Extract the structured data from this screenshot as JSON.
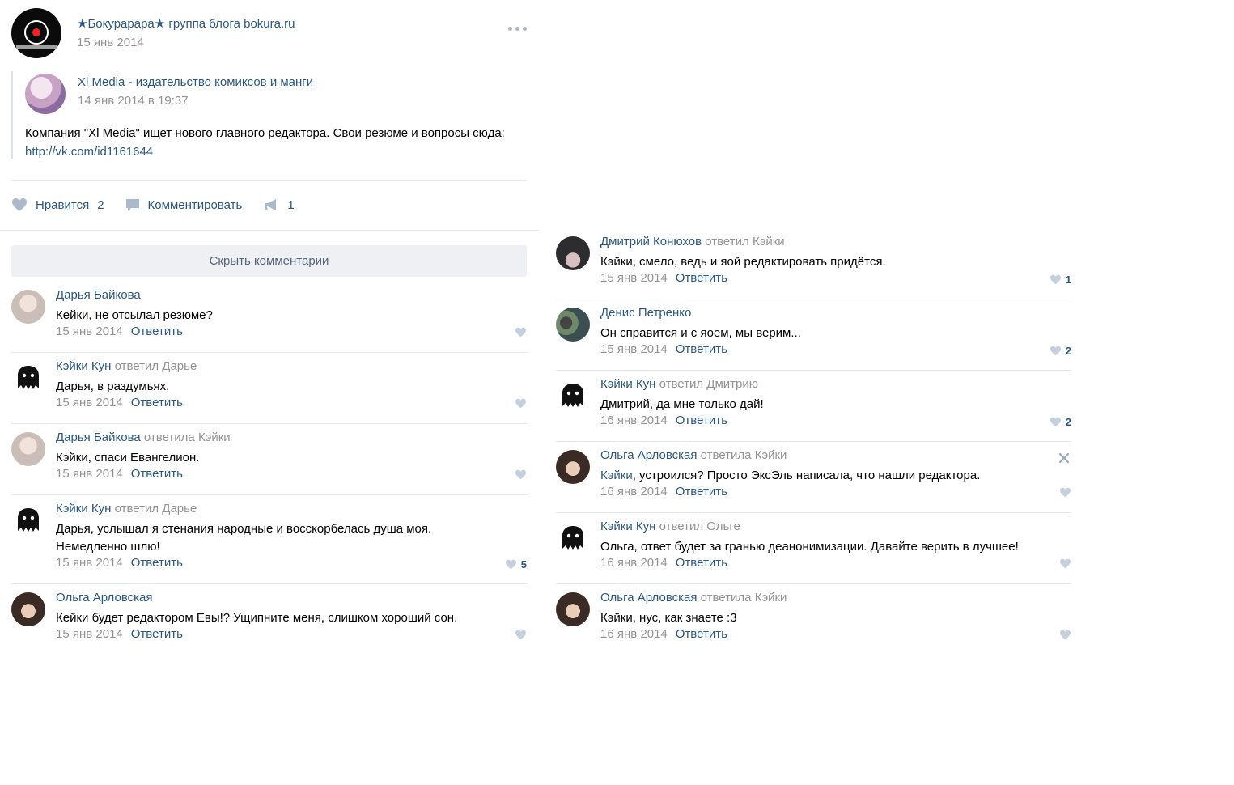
{
  "post": {
    "group_name": "★Бокурарара★ группа блога bokura.ru",
    "date": "15 янв 2014",
    "more_icon": "more-horizontal-icon",
    "repost": {
      "author": "Xl Media - издательство комиксов и манги",
      "date": "14 янв 2014 в 19:37",
      "text": "Компания \"Xl Media\" ищет нового главного редактора. Свои резюме и вопросы сюда: ",
      "link": "http://vk.com/id1161644"
    },
    "actions": {
      "like_label": "Нравится",
      "like_count": "2",
      "comment_label": "Комментировать",
      "share_count": "1"
    },
    "hide_comments": "Скрыть комментарии"
  },
  "reply_label": "Ответить",
  "comments_left": [
    {
      "author": "Дарья Байкова",
      "replied": "",
      "to": "",
      "text": "Кейки, не отсылал резюме?",
      "date": "15 янв 2014",
      "likes": "",
      "avatar": "girl"
    },
    {
      "author": "Кэйки Кун",
      "replied": "ответил",
      "to": "Дарье",
      "text": "Дарья, в раздумьях.",
      "date": "15 янв 2014",
      "likes": "",
      "avatar": "ghost"
    },
    {
      "author": "Дарья Байкова",
      "replied": "ответила",
      "to": "Кэйки",
      "text": "Кэйки, спаси Евангелион.",
      "date": "15 янв 2014",
      "likes": "",
      "avatar": "girl"
    },
    {
      "author": "Кэйки Кун",
      "replied": "ответил",
      "to": "Дарье",
      "text": "Дарья, услышал я стенания народные и восскорбелась душа моя.",
      "text2": "Немедленно шлю!",
      "date": "15 янв 2014",
      "likes": "5",
      "avatar": "ghost"
    },
    {
      "author": "Ольга Арловская",
      "replied": "",
      "to": "",
      "text": "Кейки будет редактором Евы!? Ущипните меня, слишком хороший сон.",
      "date": "15 янв 2014",
      "likes": "",
      "avatar": "olga"
    }
  ],
  "comments_right": [
    {
      "author": "Дмитрий Конюхов",
      "replied": "ответил",
      "to": "Кэйки",
      "text": "Кэйки, смело, ведь и яой редактировать придётся.",
      "date": "15 янв 2014",
      "likes": "1",
      "avatar": "dim"
    },
    {
      "author": "Денис Петренко",
      "replied": "",
      "to": "",
      "text": "Он справится и с яоем, мы верим...",
      "date": "15 янв 2014",
      "likes": "2",
      "avatar": "den"
    },
    {
      "author": "Кэйки Кун",
      "replied": "ответил",
      "to": "Дмитрию",
      "text": "Дмитрий, да мне только дай!",
      "date": "16 янв 2014",
      "likes": "2",
      "avatar": "ghost"
    },
    {
      "author": "Ольга Арловская",
      "replied": "ответила",
      "to": "Кэйки",
      "mention": "Кэйки",
      "text": ", устроился? Просто ЭксЭль написала, что нашли редактора.",
      "date": "16 янв 2014",
      "likes": "",
      "avatar": "olga",
      "closable": true
    },
    {
      "author": "Кэйки Кун",
      "replied": "ответил",
      "to": "Ольге",
      "text": "Ольга, ответ будет за гранью деанонимизации. Давайте верить в лучшее!",
      "date": "16 янв 2014",
      "likes": "",
      "avatar": "ghost"
    },
    {
      "author": "Ольга Арловская",
      "replied": "ответила",
      "to": "Кэйки",
      "text": "Кэйки, нус, как знаете :3",
      "date": "16 янв 2014",
      "likes": "",
      "avatar": "olga"
    }
  ]
}
